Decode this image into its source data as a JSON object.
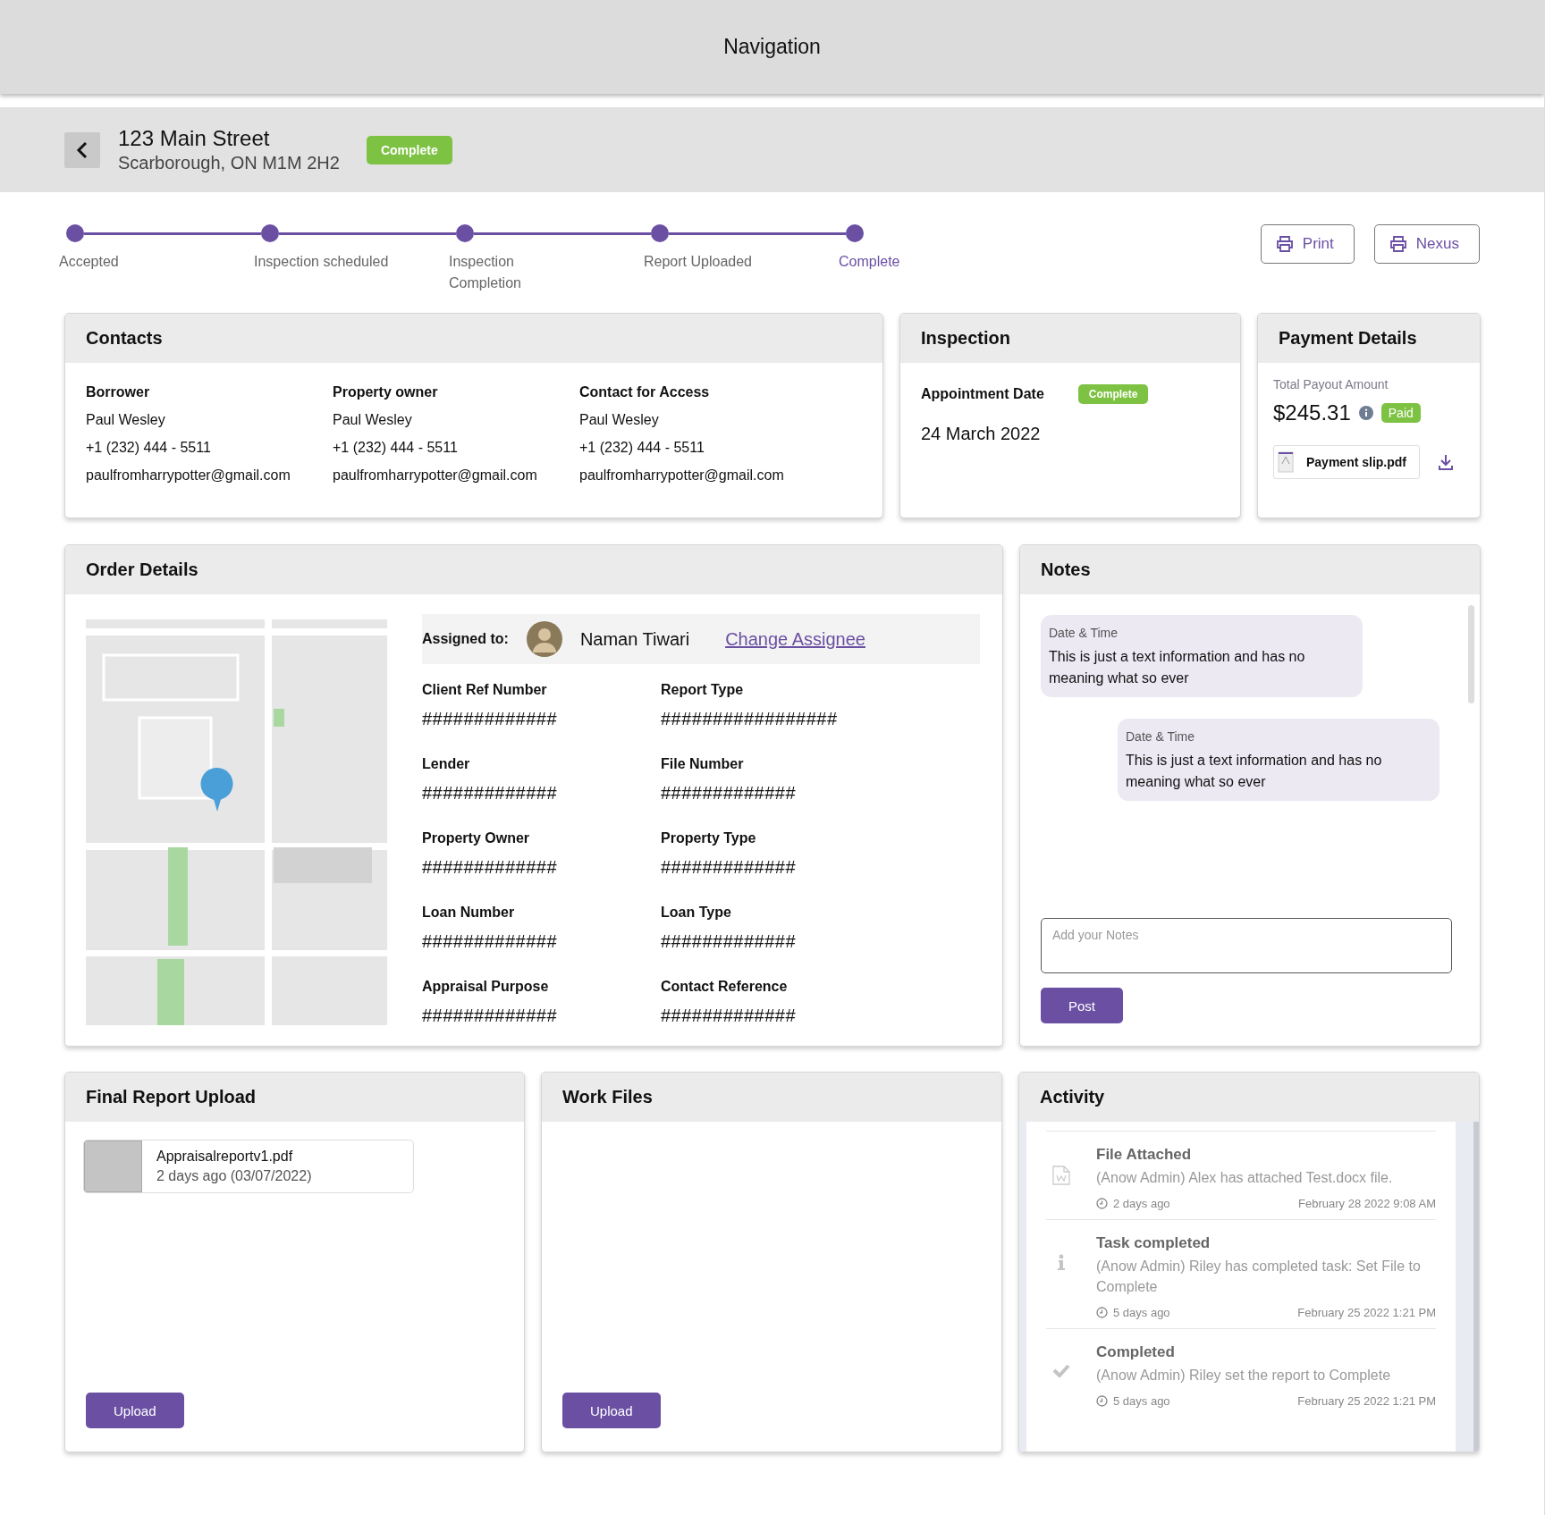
{
  "navigation": {
    "title": "Navigation"
  },
  "header": {
    "street": "123 Main Street",
    "city": "Scarborough, ON M1M 2H2",
    "status": "Complete"
  },
  "steps": [
    {
      "label": "Accepted",
      "selected": false
    },
    {
      "label": "Inspection scheduled",
      "selected": false
    },
    {
      "label": "Inspection Completion",
      "selected": false
    },
    {
      "label": "Report Uploaded",
      "selected": false
    },
    {
      "label": "Complete",
      "selected": true
    }
  ],
  "actions": [
    {
      "label": "Print"
    },
    {
      "label": "Nexus"
    }
  ],
  "contacts": {
    "title": "Contacts",
    "people": [
      {
        "role": "Borrower",
        "name": "Paul Wesley",
        "phone": "+1 (232) 444 - 5511",
        "email": "paulfromharrypotter@gmail.com"
      },
      {
        "role": "Property owner",
        "name": "Paul Wesley",
        "phone": "+1 (232) 444 - 5511",
        "email": "paulfromharrypotter@gmail.com"
      },
      {
        "role": "Contact for Access",
        "name": "Paul Wesley",
        "phone": "+1 (232) 444 - 5511",
        "email": "paulfromharrypotter@gmail.com"
      }
    ]
  },
  "inspection": {
    "title": "Inspection",
    "label": "Appointment Date",
    "status": "Complete",
    "date": "24 March 2022"
  },
  "payment": {
    "title": "Payment Details",
    "label": "Total Payout Amount",
    "amount": "$245.31",
    "status": "Paid",
    "file": "Payment slip.pdf"
  },
  "order": {
    "title": "Order Details",
    "assigned_label": "Assigned to:",
    "assignee": "Naman Tiwari",
    "change_link": "Change Assignee",
    "fields": [
      {
        "label": "Client Ref Number",
        "value": "#############"
      },
      {
        "label": "Report Type",
        "value": "#################"
      },
      {
        "label": "Lender",
        "value": "#############"
      },
      {
        "label": "File Number",
        "value": "#############"
      },
      {
        "label": "Property Owner",
        "value": "#############"
      },
      {
        "label": "Property Type",
        "value": "#############"
      },
      {
        "label": "Loan Number",
        "value": "#############"
      },
      {
        "label": "Loan Type",
        "value": "#############"
      },
      {
        "label": "Appraisal Purpose",
        "value": "#############"
      },
      {
        "label": "Contact Reference",
        "value": "#############"
      }
    ]
  },
  "notes": {
    "title": "Notes",
    "items": [
      {
        "kind": "received",
        "time": "Date & Time",
        "text": "This is just a text information and has no meaning what so ever"
      },
      {
        "kind": "sent",
        "time": "Date & Time",
        "text": "This is just a text information and has no meaning what so ever"
      }
    ],
    "placeholder": "Add your Notes",
    "button": "Post"
  },
  "final_report": {
    "title": "Final Report Upload",
    "files": [
      {
        "name": "Appraisalreportv1.pdf",
        "meta": "2 days ago (03/07/2022)"
      }
    ],
    "button": "Upload"
  },
  "work_files": {
    "title": "Work Files",
    "button": "Upload"
  },
  "activity": {
    "title": "Activity",
    "items": [
      {
        "kind": "file",
        "title": "File Attached",
        "text": "(Anow Admin) Alex has attached Test.docx file.",
        "ago": "2 days ago",
        "date": "February 28 2022 9:08 AM"
      },
      {
        "kind": "info",
        "title": "Task completed",
        "text": "(Anow Admin) Riley has completed task: Set File to Complete",
        "ago": "5 days ago",
        "date": "February 25 2022 1:21 PM"
      },
      {
        "kind": "check",
        "title": "Completed",
        "text": "(Anow Admin) Riley set the report to Complete",
        "ago": "5 days ago",
        "date": "February 25 2022 1:21 PM"
      }
    ]
  }
}
